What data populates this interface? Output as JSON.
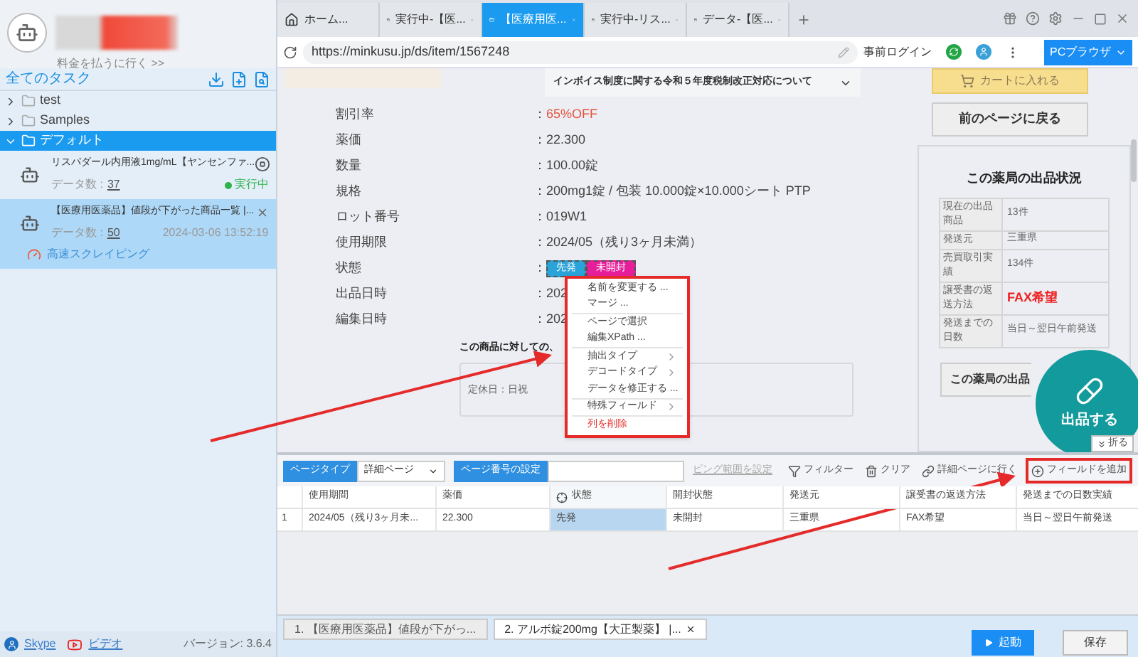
{
  "sidebar": {
    "pay_link": "料金を払うに行く >>",
    "section_title": "全てのタスク",
    "folders": [
      {
        "name": "test",
        "expanded": false,
        "selected": false
      },
      {
        "name": "Samples",
        "expanded": false,
        "selected": false
      },
      {
        "name": "デフォルト",
        "expanded": true,
        "selected": true,
        "children": [
          {
            "title": "リスパダール内用液1mg/mL【ヤンセンファ...",
            "count_label": "データ数 :",
            "count": "37",
            "running": true,
            "status": "実行中",
            "selected": false
          },
          {
            "title": "【医療用医薬品】値段が下がった商品一覧 |...",
            "count_label": "データ数 :",
            "count": "50",
            "running": false,
            "date": "2024-03-06 13:52:19",
            "mode": "高速スクレイピング",
            "selected": true
          }
        ]
      }
    ],
    "footer_links": [
      "Skype",
      "ビデオ"
    ],
    "version": "バージョン: 3.6.4"
  },
  "tabs": [
    {
      "kind": "home",
      "label": "ホーム...",
      "selected": false
    },
    {
      "kind": "page",
      "label": "実行中-【医...",
      "selected": false
    },
    {
      "kind": "page",
      "label": "【医療用医...",
      "selected": true
    },
    {
      "kind": "page",
      "label": "実行中-リス...",
      "selected": false
    },
    {
      "kind": "page",
      "label": "データ-【医...",
      "selected": false
    }
  ],
  "address": {
    "url": "https://minkusu.jp/ds/item/1567248",
    "login": "事前ログイン",
    "browser": "PCブラウザ"
  },
  "page": {
    "notice": "インボイス制度に関する令和５年度税制改正対応について",
    "details": [
      {
        "kind": "discount",
        "label": "割引率",
        "sep": "：",
        "value": "65%OFF"
      },
      {
        "kind": "text",
        "label": "薬価",
        "sep": "：",
        "value": "22.300"
      },
      {
        "kind": "text",
        "label": "数量",
        "sep": "：",
        "value": "100.00錠"
      },
      {
        "kind": "text",
        "label": "規格",
        "sep": "：",
        "value": "200mg1錠 / 包装 10.000錠×10.000シート PTP"
      },
      {
        "kind": "text",
        "label": "ロット番号",
        "sep": "：",
        "value": "019W1"
      },
      {
        "kind": "text",
        "label": "使用期限",
        "sep": "：",
        "value": "2024/05（残り3ヶ月未満）"
      },
      {
        "kind": "badges",
        "label": "状態",
        "sep": "：",
        "badges": [
          {
            "text": "先発",
            "color": "#29a3d8"
          },
          {
            "text": "未開封",
            "color": "#e61e9a"
          }
        ]
      },
      {
        "kind": "text",
        "label": "出品日時",
        "sep": "：",
        "value": "202"
      },
      {
        "kind": "text",
        "label": "編集日時",
        "sep": "：",
        "value": "202"
      }
    ],
    "section_heading": "この商品に対しての、",
    "note": "定休日：日祝",
    "cart_button": "カートに入れる",
    "back_button": "前のページに戻る",
    "store": {
      "title": "この薬局の出品状況",
      "rows": [
        {
          "label": "現在の出品商品",
          "value": "13件",
          "emphasis": false
        },
        {
          "label": "発送元",
          "value": "三重県",
          "emphasis": false
        },
        {
          "label": "売買取引実績",
          "value": "134件",
          "emphasis": false
        },
        {
          "label": "譲受書の返送方法",
          "value": "FAX希望",
          "emphasis": true
        },
        {
          "label": "発送までの日数",
          "value": "当日～翌日午前発送",
          "emphasis": false
        }
      ],
      "button": "この薬局の出品"
    },
    "float_button": "出品する",
    "fold_button": "折る"
  },
  "menu": {
    "groups": [
      [
        {
          "kind": "action",
          "label": "名前を変更する ..."
        },
        {
          "kind": "action",
          "label": "マージ ..."
        }
      ],
      [
        {
          "kind": "action",
          "label": "ページで選択"
        },
        {
          "kind": "action",
          "label": "編集XPath ..."
        }
      ],
      [
        {
          "kind": "submenu",
          "label": "抽出タイプ"
        },
        {
          "kind": "submenu",
          "label": "デコードタイプ"
        },
        {
          "kind": "action",
          "label": "データを修正する ..."
        }
      ],
      [
        {
          "kind": "submenu",
          "label": "特殊フィールド"
        }
      ],
      [
        {
          "kind": "danger",
          "label": "列を削除"
        }
      ]
    ]
  },
  "toolbar": {
    "page_type_label": "ページタイプ",
    "page_type": "詳細ページ",
    "page_number_label": "ページ番号の設定",
    "range_link": "ピング範囲を設定",
    "tools": [
      {
        "kind": "filter",
        "label": "フィルター",
        "annotated": false
      },
      {
        "kind": "clear",
        "label": "クリア",
        "annotated": false
      },
      {
        "kind": "link",
        "label": "詳細ページに行く",
        "annotated": false
      },
      {
        "kind": "add",
        "label": "フィールドを追加",
        "annotated": true
      }
    ]
  },
  "table": {
    "columns": [
      {
        "label": "使用期間",
        "selected": false
      },
      {
        "label": "薬価",
        "selected": false
      },
      {
        "label": "状態",
        "selected": true
      },
      {
        "label": "開封状態",
        "selected": false
      },
      {
        "label": "発送元",
        "selected": false
      },
      {
        "label": "譲受書の返送方法",
        "selected": false
      },
      {
        "label": "発送までの日数実績",
        "selected": false
      }
    ],
    "rows": [
      {
        "index": "1",
        "cells": [
          "2024/05（残り3ヶ月未...",
          "22.300",
          "先発",
          "未開封",
          "三重県",
          "FAX希望",
          "当日～翌日午前発送"
        ]
      }
    ]
  },
  "bottom_tabs": [
    {
      "label": "1. 【医療用医薬品】値段が下がっ...",
      "selected": false
    },
    {
      "label": "2. アルボ錠200mg【大正製薬】 |...",
      "selected": true
    }
  ],
  "actions": {
    "start": "起動",
    "save": "保存"
  }
}
